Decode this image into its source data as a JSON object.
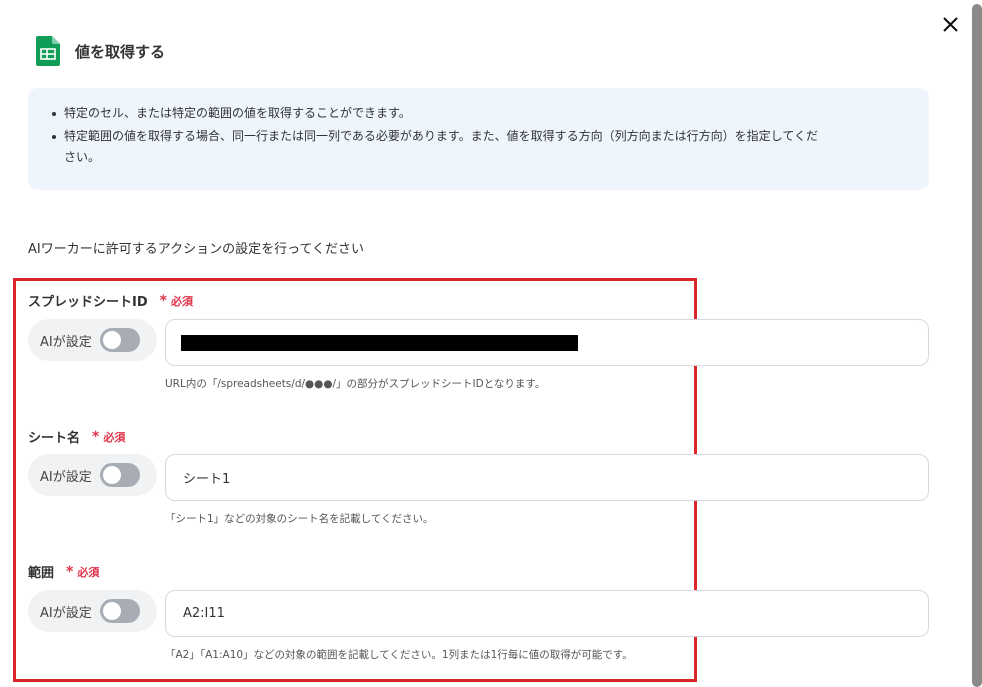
{
  "page": {
    "title": "値を取得する",
    "icon": "google-sheets-icon"
  },
  "close": {
    "icon": "close-icon"
  },
  "info": {
    "items": [
      "特定のセル、または特定の範囲の値を取得することができます。",
      "特定範囲の値を取得する場合、同一行または同一列である必要があります。また、値を取得する方向（列方向または行方向）を指定してくだ",
      "さい。"
    ]
  },
  "section_intro": "AIワーカーに許可するアクションの設定を行ってください",
  "required_label": "必須",
  "ai_toggle_label": "AIが設定",
  "fields": {
    "spreadsheet_id": {
      "label": "スプレッドシートID",
      "value": "",
      "redacted": true,
      "hint": "URL内の「/spreadsheets/d/●●●/」の部分がスプレッドシートIDとなります。",
      "ai_enabled": false
    },
    "sheet_name": {
      "label": "シート名",
      "value": "シート1",
      "hint": "「シート1」などの対象のシート名を記載してください。",
      "ai_enabled": false
    },
    "range": {
      "label": "範囲",
      "value": "A2:I11",
      "hint": "「A2」「A1:A10」などの対象の範囲を記載してください。1列または1行毎に値の取得が可能です。",
      "ai_enabled": false
    }
  },
  "colors": {
    "required": "#e0334a",
    "highlight": "#d9262a",
    "info_bg": "#eef5fd",
    "sheets_green": "#0f9d58"
  }
}
